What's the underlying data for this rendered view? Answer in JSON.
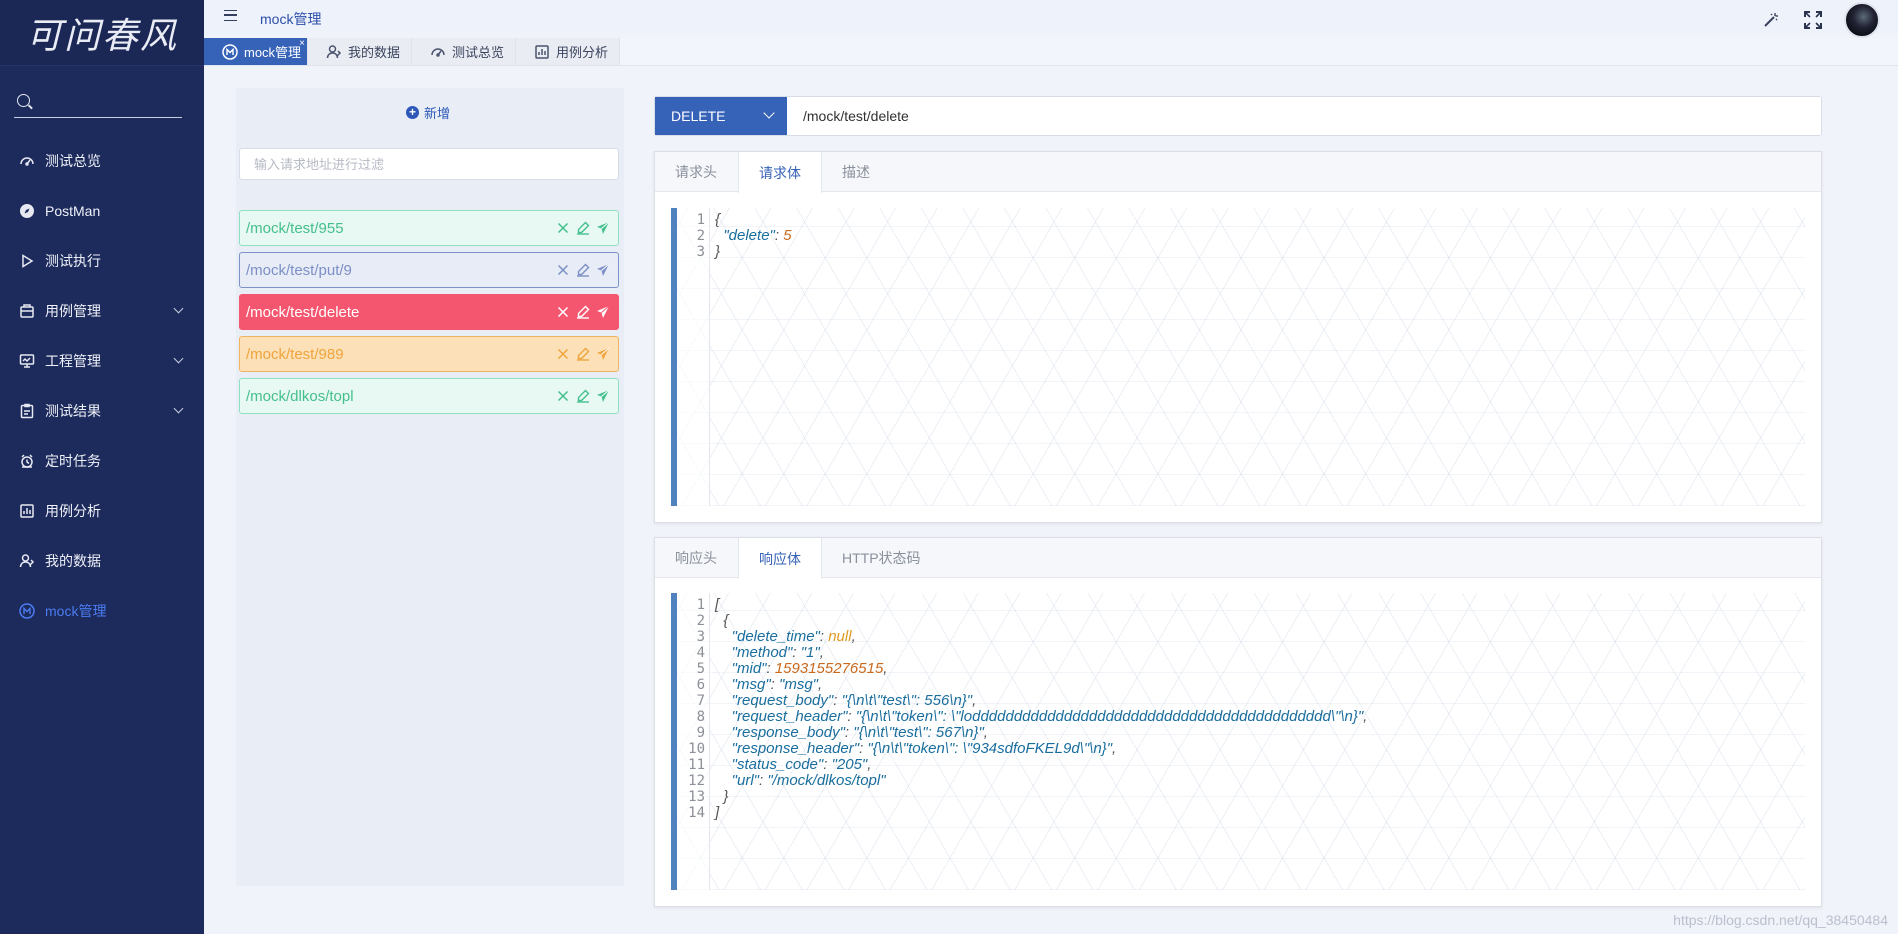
{
  "brand": {
    "logo_text": "可问春风"
  },
  "sidebar": {
    "items": [
      {
        "label": "测试总览",
        "icon": "dashboard-icon",
        "has_children": false,
        "active": false
      },
      {
        "label": "PostMan",
        "icon": "compass-icon",
        "has_children": false,
        "active": false
      },
      {
        "label": "测试执行",
        "icon": "play-icon",
        "has_children": false,
        "active": false
      },
      {
        "label": "用例管理",
        "icon": "folder-icon",
        "has_children": true,
        "active": false
      },
      {
        "label": "工程管理",
        "icon": "monitor-icon",
        "has_children": true,
        "active": false
      },
      {
        "label": "测试结果",
        "icon": "clipboard-icon",
        "has_children": true,
        "active": false
      },
      {
        "label": "定时任务",
        "icon": "alarm-icon",
        "has_children": false,
        "active": false
      },
      {
        "label": "用例分析",
        "icon": "chart-icon",
        "has_children": false,
        "active": false
      },
      {
        "label": "我的数据",
        "icon": "user-icon",
        "has_children": false,
        "active": false
      },
      {
        "label": "mock管理",
        "icon": "m-circle-icon",
        "has_children": false,
        "active": true
      }
    ]
  },
  "topbar": {
    "breadcrumb": "mock管理"
  },
  "page_tabs": [
    {
      "label": "mock管理",
      "active": true,
      "closable": true,
      "close_glyph": "×"
    },
    {
      "label": "我的数据",
      "active": false
    },
    {
      "label": "测试总览",
      "active": false
    },
    {
      "label": "用例分析",
      "active": false
    }
  ],
  "mock_list": {
    "add_label": "新增",
    "filter_placeholder": "输入请求地址进行过滤",
    "items": [
      {
        "url": "/mock/test/955",
        "style": "green"
      },
      {
        "url": "/mock/test/put/9",
        "style": "blue"
      },
      {
        "url": "/mock/test/delete",
        "style": "red"
      },
      {
        "url": "/mock/test/989",
        "style": "orange"
      },
      {
        "url": "/mock/dlkos/topl",
        "style": "green"
      }
    ]
  },
  "request": {
    "method": "DELETE",
    "url": "/mock/test/delete",
    "tabs": [
      "请求头",
      "请求体",
      "描述"
    ],
    "active_tab": 1,
    "body_lines": [
      [
        [
          "p",
          "{"
        ]
      ],
      [
        [
          "p",
          "  "
        ],
        [
          "k",
          "\"delete\""
        ],
        [
          "p",
          ": "
        ],
        [
          "n",
          "5"
        ]
      ],
      [
        [
          "p",
          "}"
        ]
      ]
    ]
  },
  "response": {
    "tabs": [
      "响应头",
      "响应体",
      "HTTP状态码"
    ],
    "active_tab": 1,
    "body_lines": [
      [
        [
          "p",
          "["
        ]
      ],
      [
        [
          "p",
          "  {"
        ]
      ],
      [
        [
          "p",
          "    "
        ],
        [
          "k",
          "\"delete_time\""
        ],
        [
          "p",
          ": "
        ],
        [
          "nl",
          "null"
        ],
        [
          "p",
          ","
        ]
      ],
      [
        [
          "p",
          "    "
        ],
        [
          "k",
          "\"method\""
        ],
        [
          "p",
          ": "
        ],
        [
          "s",
          "\"1\""
        ],
        [
          "p",
          ","
        ]
      ],
      [
        [
          "p",
          "    "
        ],
        [
          "k",
          "\"mid\""
        ],
        [
          "p",
          ": "
        ],
        [
          "n",
          "1593155276515"
        ],
        [
          "p",
          ","
        ]
      ],
      [
        [
          "p",
          "    "
        ],
        [
          "k",
          "\"msg\""
        ],
        [
          "p",
          ": "
        ],
        [
          "s",
          "\"msg\""
        ],
        [
          "p",
          ","
        ]
      ],
      [
        [
          "p",
          "    "
        ],
        [
          "k",
          "\"request_body\""
        ],
        [
          "p",
          ": "
        ],
        [
          "s",
          "\"{\\n\\t\\\"test\\\": 556\\n}\""
        ],
        [
          "p",
          ","
        ]
      ],
      [
        [
          "p",
          "    "
        ],
        [
          "k",
          "\"request_header\""
        ],
        [
          "p",
          ": "
        ],
        [
          "s",
          "\"{\\n\\t\\\"token\\\": \\\"loddddddddddddddddddddddddddddddddddddddddddd\\\"\\n}\""
        ],
        [
          "p",
          ","
        ]
      ],
      [
        [
          "p",
          "    "
        ],
        [
          "k",
          "\"response_body\""
        ],
        [
          "p",
          ": "
        ],
        [
          "s",
          "\"{\\n\\t\\\"test\\\": 567\\n}\""
        ],
        [
          "p",
          ","
        ]
      ],
      [
        [
          "p",
          "    "
        ],
        [
          "k",
          "\"response_header\""
        ],
        [
          "p",
          ": "
        ],
        [
          "s",
          "\"{\\n\\t\\\"token\\\": \\\"934sdfoFKEL9d\\\"\\n}\""
        ],
        [
          "p",
          ","
        ]
      ],
      [
        [
          "p",
          "    "
        ],
        [
          "k",
          "\"status_code\""
        ],
        [
          "p",
          ": "
        ],
        [
          "s",
          "\"205\""
        ],
        [
          "p",
          ","
        ]
      ],
      [
        [
          "p",
          "    "
        ],
        [
          "k",
          "\"url\""
        ],
        [
          "p",
          ": "
        ],
        [
          "s",
          "\"/mock/dlkos/topl\""
        ]
      ],
      [
        [
          "p",
          "  }"
        ]
      ],
      [
        [
          "p",
          "]"
        ]
      ]
    ]
  },
  "watermark": "https://blog.csdn.net/qq_38450484",
  "colors": {
    "sidebar_bg": "#1d2a5c",
    "accent": "#3662b8",
    "active_nav": "#4a7cf0",
    "danger": "#f5566f"
  }
}
